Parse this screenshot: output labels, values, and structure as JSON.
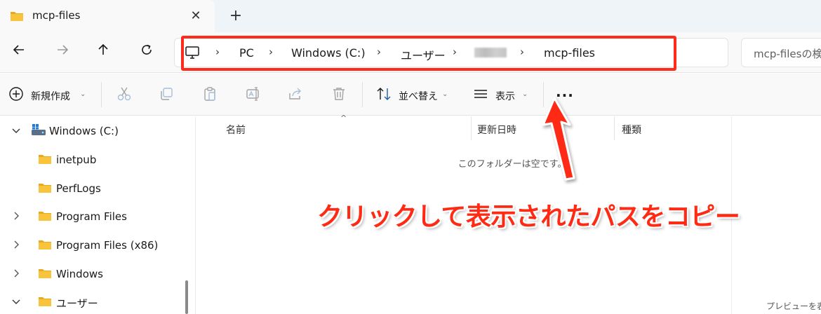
{
  "tab": {
    "title": "mcp-files",
    "close_icon": "close-icon",
    "new_tab_icon": "plus-icon"
  },
  "nav": {
    "back_icon": "arrow-left-icon",
    "forward_icon": "arrow-right-icon",
    "up_icon": "arrow-up-icon",
    "refresh_icon": "refresh-icon"
  },
  "address": {
    "pc_icon": "monitor-icon",
    "crumbs": [
      "PC",
      "Windows (C:)",
      "ユーザー",
      "",
      "mcp-files"
    ],
    "separator": "›"
  },
  "search": {
    "placeholder": "mcp-filesの検索"
  },
  "commands": {
    "new_label": "新規作成",
    "sort_label": "並べ替え",
    "view_label": "表示",
    "more_label": "..."
  },
  "sidebar": {
    "items": [
      {
        "label": "Windows (C:)",
        "expanded": true
      },
      {
        "label": "inetpub"
      },
      {
        "label": "PerfLogs"
      },
      {
        "label": "Program Files"
      },
      {
        "label": "Program Files (x86)"
      },
      {
        "label": "Windows"
      },
      {
        "label": "ユーザー",
        "expanded": true
      }
    ]
  },
  "filelist": {
    "columns": [
      "名前",
      "更新日時",
      "種類"
    ],
    "empty_message": "このフォルダーは空です。",
    "sort_caret": "^"
  },
  "preview": {
    "text": "プレビューを表示"
  },
  "annotation": {
    "text": "クリックして表示されたパスをコピー"
  },
  "colors": {
    "annotation_red": "#ff2a14",
    "folder_yellow": "#f8c43c",
    "background": "#f9f9f9"
  }
}
